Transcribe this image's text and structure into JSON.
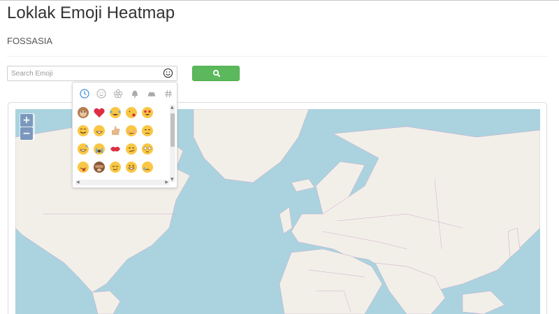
{
  "page": {
    "title": "Loklak Emoji Heatmap",
    "subtitle": "FOSSASIA"
  },
  "search": {
    "placeholder": "Search Emoji",
    "value": "",
    "button_icon": "search-icon",
    "emoji_toggle_icon": "smiley-icon"
  },
  "colors": {
    "button_green": "#5cb85c",
    "map_water": "#aad3df",
    "map_land": "#f2efe9",
    "zoom_blue": "#7b98bc"
  },
  "map": {
    "zoom_in_label": "+",
    "zoom_out_label": "−"
  },
  "emoji_picker": {
    "tabs": [
      "recent-clock-icon",
      "smileys-icon",
      "nature-flower-icon",
      "objects-bell-icon",
      "travel-car-icon",
      "symbols-hash-icon"
    ],
    "active_tab": 0,
    "emojis": [
      [
        "monkey-face",
        "red-heart",
        "tears-of-joy",
        "face-blowing-kiss",
        "heart-eyes"
      ],
      [
        "smiling-face",
        "beaming-face",
        "thumbs-up",
        "relieved-face",
        "unamused-face"
      ],
      [
        "grinning-sweat",
        "loudly-crying",
        "kiss-mark",
        "smirking-face",
        "flushed-face"
      ],
      [
        "winking-tongue",
        "see-no-evil-monkey",
        "relieved-smirk",
        "grinning-face",
        "crying-face"
      ]
    ]
  }
}
